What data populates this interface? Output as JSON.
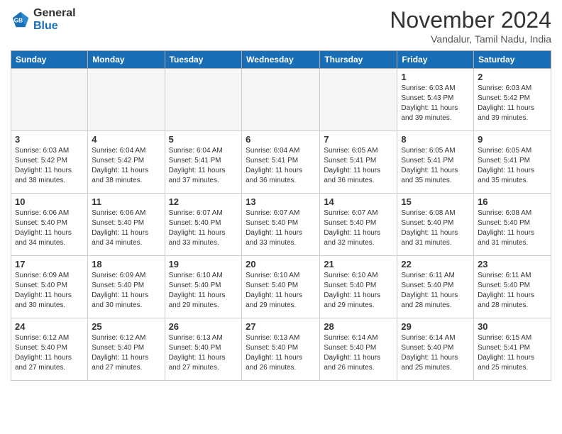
{
  "header": {
    "logo": {
      "line1": "General",
      "line2": "Blue"
    },
    "title": "November 2024",
    "location": "Vandalur, Tamil Nadu, India"
  },
  "weekdays": [
    "Sunday",
    "Monday",
    "Tuesday",
    "Wednesday",
    "Thursday",
    "Friday",
    "Saturday"
  ],
  "weeks": [
    [
      {
        "day": "",
        "empty": true
      },
      {
        "day": "",
        "empty": true
      },
      {
        "day": "",
        "empty": true
      },
      {
        "day": "",
        "empty": true
      },
      {
        "day": "",
        "empty": true
      },
      {
        "day": "1",
        "sunrise": "6:03 AM",
        "sunset": "5:43 PM",
        "daylight": "11 hours and 39 minutes."
      },
      {
        "day": "2",
        "sunrise": "6:03 AM",
        "sunset": "5:42 PM",
        "daylight": "11 hours and 39 minutes."
      }
    ],
    [
      {
        "day": "3",
        "sunrise": "6:03 AM",
        "sunset": "5:42 PM",
        "daylight": "11 hours and 38 minutes."
      },
      {
        "day": "4",
        "sunrise": "6:04 AM",
        "sunset": "5:42 PM",
        "daylight": "11 hours and 38 minutes."
      },
      {
        "day": "5",
        "sunrise": "6:04 AM",
        "sunset": "5:41 PM",
        "daylight": "11 hours and 37 minutes."
      },
      {
        "day": "6",
        "sunrise": "6:04 AM",
        "sunset": "5:41 PM",
        "daylight": "11 hours and 36 minutes."
      },
      {
        "day": "7",
        "sunrise": "6:05 AM",
        "sunset": "5:41 PM",
        "daylight": "11 hours and 36 minutes."
      },
      {
        "day": "8",
        "sunrise": "6:05 AM",
        "sunset": "5:41 PM",
        "daylight": "11 hours and 35 minutes."
      },
      {
        "day": "9",
        "sunrise": "6:05 AM",
        "sunset": "5:41 PM",
        "daylight": "11 hours and 35 minutes."
      }
    ],
    [
      {
        "day": "10",
        "sunrise": "6:06 AM",
        "sunset": "5:40 PM",
        "daylight": "11 hours and 34 minutes."
      },
      {
        "day": "11",
        "sunrise": "6:06 AM",
        "sunset": "5:40 PM",
        "daylight": "11 hours and 34 minutes."
      },
      {
        "day": "12",
        "sunrise": "6:07 AM",
        "sunset": "5:40 PM",
        "daylight": "11 hours and 33 minutes."
      },
      {
        "day": "13",
        "sunrise": "6:07 AM",
        "sunset": "5:40 PM",
        "daylight": "11 hours and 33 minutes."
      },
      {
        "day": "14",
        "sunrise": "6:07 AM",
        "sunset": "5:40 PM",
        "daylight": "11 hours and 32 minutes."
      },
      {
        "day": "15",
        "sunrise": "6:08 AM",
        "sunset": "5:40 PM",
        "daylight": "11 hours and 31 minutes."
      },
      {
        "day": "16",
        "sunrise": "6:08 AM",
        "sunset": "5:40 PM",
        "daylight": "11 hours and 31 minutes."
      }
    ],
    [
      {
        "day": "17",
        "sunrise": "6:09 AM",
        "sunset": "5:40 PM",
        "daylight": "11 hours and 30 minutes."
      },
      {
        "day": "18",
        "sunrise": "6:09 AM",
        "sunset": "5:40 PM",
        "daylight": "11 hours and 30 minutes."
      },
      {
        "day": "19",
        "sunrise": "6:10 AM",
        "sunset": "5:40 PM",
        "daylight": "11 hours and 29 minutes."
      },
      {
        "day": "20",
        "sunrise": "6:10 AM",
        "sunset": "5:40 PM",
        "daylight": "11 hours and 29 minutes."
      },
      {
        "day": "21",
        "sunrise": "6:10 AM",
        "sunset": "5:40 PM",
        "daylight": "11 hours and 29 minutes."
      },
      {
        "day": "22",
        "sunrise": "6:11 AM",
        "sunset": "5:40 PM",
        "daylight": "11 hours and 28 minutes."
      },
      {
        "day": "23",
        "sunrise": "6:11 AM",
        "sunset": "5:40 PM",
        "daylight": "11 hours and 28 minutes."
      }
    ],
    [
      {
        "day": "24",
        "sunrise": "6:12 AM",
        "sunset": "5:40 PM",
        "daylight": "11 hours and 27 minutes."
      },
      {
        "day": "25",
        "sunrise": "6:12 AM",
        "sunset": "5:40 PM",
        "daylight": "11 hours and 27 minutes."
      },
      {
        "day": "26",
        "sunrise": "6:13 AM",
        "sunset": "5:40 PM",
        "daylight": "11 hours and 27 minutes."
      },
      {
        "day": "27",
        "sunrise": "6:13 AM",
        "sunset": "5:40 PM",
        "daylight": "11 hours and 26 minutes."
      },
      {
        "day": "28",
        "sunrise": "6:14 AM",
        "sunset": "5:40 PM",
        "daylight": "11 hours and 26 minutes."
      },
      {
        "day": "29",
        "sunrise": "6:14 AM",
        "sunset": "5:40 PM",
        "daylight": "11 hours and 25 minutes."
      },
      {
        "day": "30",
        "sunrise": "6:15 AM",
        "sunset": "5:41 PM",
        "daylight": "11 hours and 25 minutes."
      }
    ]
  ]
}
